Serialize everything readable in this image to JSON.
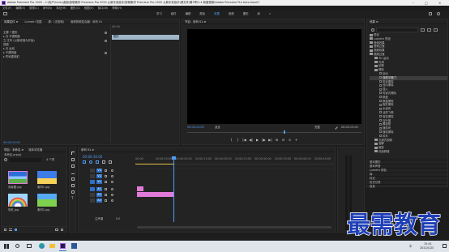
{
  "title_bar": {
    "title": "Adobe Premiere Pro 2020 - C:\\用户\\Ucdu\\桌面\\剪辑素材 Premiere Pro 2020 从新手到高手\\剪辑素材 Premiere Pro 2020 从新手到高手\\源文件\\第2章\\2.4 新建视频\\Adobe Premiere Pro Auto-Save\\*",
    "controls": [
      "–",
      "□",
      "×"
    ]
  },
  "menu": [
    "文件(F)",
    "编辑(E)",
    "剪辑(C)",
    "序列(S)",
    "标记(M)",
    "图形(G)",
    "视图(V)",
    "窗口(W)",
    "帮助(H)"
  ],
  "workspaces": [
    "学习",
    "组件",
    "编辑",
    "颜色",
    "效果",
    "音频",
    "图形",
    "库",
    "»"
  ],
  "effect_controls": {
    "tabs": [
      "效果控件 ≡",
      "Lumetri 范围",
      "源：(无剪辑)",
      "音频剪辑混合器：序列 01"
    ],
    "rows": [
      "主要 * 图形",
      "运动",
      "不透明度",
      "时间重映射",
      "视频",
      "音频",
      "不透明度",
      "时间重映射"
    ],
    "rows_full": [
      "主要 * 图形",
      "▸ 月 不透明度",
      "立 文本 (以新段落为开始)",
      "视频",
      "▸ 月 运动",
      "▸ 不透明度",
      "▸ 时间重映射"
    ],
    "timecode": "00:00:10:00",
    "clip_label": "图形"
  },
  "program_monitor": {
    "tab": "节目：序列 01 ≡",
    "timecode_left": "00:00:10:00",
    "fit": "适合",
    "quality": "完整",
    "timecode_right": "00:00:15:00",
    "transport": [
      "{",
      "}",
      "|◀",
      "◀|",
      "▶",
      "|▶",
      "▶|",
      "⊞",
      "⊟",
      "⊙",
      "+"
    ]
  },
  "effects": {
    "tab": "效果 ≡",
    "items": [
      {
        "label": "预设",
        "level": 0,
        "type": "folder"
      },
      {
        "label": "Lumetri 预设",
        "level": 0,
        "type": "folder"
      },
      {
        "label": "音频效果",
        "level": 0,
        "type": "folder"
      },
      {
        "label": "音频过渡",
        "level": 0,
        "type": "folder"
      },
      {
        "label": "视频效果",
        "level": 0,
        "type": "folder"
      },
      {
        "label": "视频过渡",
        "level": 0,
        "type": "folder"
      },
      {
        "label": "3D 运动",
        "level": 1,
        "type": "folder"
      },
      {
        "label": "内滑",
        "level": 1,
        "type": "folder"
      },
      {
        "label": "划像",
        "level": 1,
        "type": "folder"
      },
      {
        "label": "擦除",
        "level": 1,
        "type": "folder"
      },
      {
        "label": "划出",
        "level": 2,
        "type": "item"
      },
      {
        "label": "双侧平推门",
        "level": 2,
        "type": "item",
        "selected": true
      },
      {
        "label": "带状擦除",
        "level": 2,
        "type": "item"
      },
      {
        "label": "径向擦除",
        "level": 2,
        "type": "item"
      },
      {
        "label": "插入",
        "level": 2,
        "type": "item"
      },
      {
        "label": "时钟式擦除",
        "level": 2,
        "type": "item"
      },
      {
        "label": "棋盘",
        "level": 2,
        "type": "item"
      },
      {
        "label": "棋盘擦除",
        "level": 2,
        "type": "item"
      },
      {
        "label": "楔形擦除",
        "level": 2,
        "type": "item"
      },
      {
        "label": "水波块",
        "level": 2,
        "type": "item"
      },
      {
        "label": "油漆飞溅",
        "level": 2,
        "type": "item"
      },
      {
        "label": "渐变擦除",
        "level": 2,
        "type": "item"
      },
      {
        "label": "百叶窗",
        "level": 2,
        "type": "item"
      },
      {
        "label": "螺旋框",
        "level": 2,
        "type": "item"
      },
      {
        "label": "随机块",
        "level": 2,
        "type": "item"
      },
      {
        "label": "随机擦除",
        "level": 2,
        "type": "item"
      },
      {
        "label": "风车",
        "level": 2,
        "type": "item"
      },
      {
        "label": "沉浸式视频",
        "level": 1,
        "type": "folder"
      },
      {
        "label": "溶解",
        "level": 1,
        "type": "folder"
      },
      {
        "label": "缩放",
        "level": 1,
        "type": "folder"
      },
      {
        "label": "页面剥落",
        "level": 1,
        "type": "folder"
      }
    ],
    "bottom": [
      "基本图形",
      "基本声音",
      "Lumetri 颜色",
      "库",
      "标记",
      "历史记录",
      "信息"
    ]
  },
  "project": {
    "tabs": [
      "项目：未命名 ≡",
      "媒体浏览器"
    ],
    "path": "未命名.prproj",
    "count": "4 个项",
    "items": [
      {
        "name": "背景图.jpg",
        "dur": "5:00"
      },
      {
        "name": "素材1.jpg",
        "dur": "5:00"
      },
      {
        "name": "彩虹.jpg",
        "dur": "5:00"
      },
      {
        "name": "素材2.jpg",
        "dur": "5:00"
      }
    ]
  },
  "timeline": {
    "tab": "序列 01 ≡",
    "timecode": "00:00:10:00",
    "ruler": [
      "00:00",
      "00:00:05:00",
      "00:00:10:00",
      "00:00:15:00",
      "00:00:20:00",
      "00:00:25:00",
      "00:00:30:00",
      "00:00:35:00",
      "00:00:40:00",
      "00:00:45:00"
    ],
    "tracks": [
      "V3",
      "V2",
      "V1",
      "A1",
      "A2",
      "A3"
    ],
    "master": "主声道",
    "master_val": "0.0"
  },
  "watermark": "最需教育",
  "taskbar": {
    "search_icon": "search-icon",
    "time": "15:41",
    "date": "2022/1/20",
    "lang": "中"
  },
  "colors": {
    "accent": "#4f9df5",
    "clip": "#e27ad8",
    "playhead": "#4f9df5"
  }
}
